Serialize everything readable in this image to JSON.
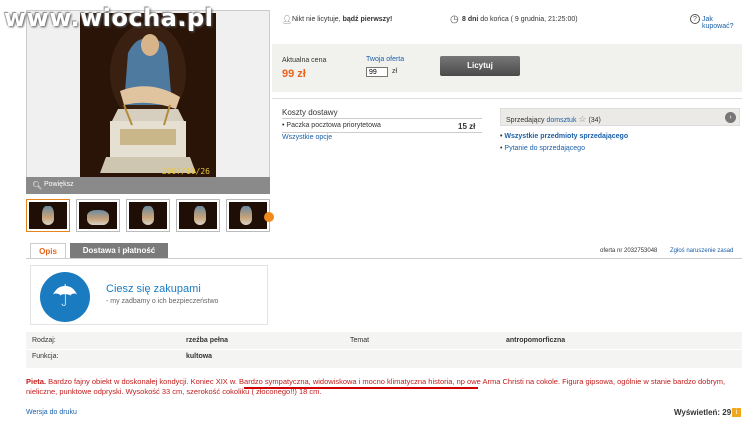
{
  "watermark": "www.wiocha.pl",
  "photo": {
    "zoom_label": "Powiększ",
    "date_stamp": "2007/10/26"
  },
  "top": {
    "bid_info_prefix": "Nikt nie licytuje,",
    "bid_info_bold": "bądź pierwszy!",
    "end_bold": "8 dni",
    "end_rest": "do końca ( 9 grudnia, 21:25:00)",
    "help_link": "Jak kupować?"
  },
  "price": {
    "label": "Aktualna cena",
    "value": "99 zł",
    "offer_label": "Twoja oferta",
    "offer_value": "99",
    "offer_unit": "zł",
    "bid_button": "Licytuj"
  },
  "shipping": {
    "title": "Koszty dostawy",
    "item": "Paczka pocztowa priorytetowa",
    "item_price": "15 zł",
    "all_options": "Wszystkie opcje"
  },
  "seller": {
    "prefix": "Sprzedający",
    "name": "domsztuk",
    "rating": "(34)",
    "link_items": "Wszystkie przedmioty sprzedającego",
    "link_ask": "Pytanie do sprzedającego"
  },
  "tabs": {
    "opis": "Opis",
    "dostawa": "Dostawa i płatność"
  },
  "offer_number": "oferta nr 2032753048",
  "report_link": "Zgłoś naruszenie zasad",
  "banner": {
    "title": "Ciesz się zakupami",
    "subtitle": "my zadbamy o ich bezpieczeństwo"
  },
  "attributes": {
    "rodzaj_label": "Rodzaj:",
    "rodzaj_value": "rzeźba pełna",
    "temat_label": "Temat",
    "temat_value": "antropomorficzna",
    "funkcja_label": "Funkcja:",
    "funkcja_value": "kultowa"
  },
  "description": {
    "bold": "Pieta.",
    "part1": " Bardzo fajny obiekt w doskonałej kondycji. Koniec XIX w. ",
    "highlight": "Bardzo sympatyczna, widowiskowa i mocno klimatyczna historia",
    "part2": ", np owe Arma Christi na cokole. Figura gipsowa, ogólnie w stanie bardzo dobrym, nieliczne, punktowe odpryski. Wysokość 33 cm, szerokość cokoliku ( złoconego!!) 18 cm."
  },
  "footer": {
    "print_link": "Wersja do druku",
    "views_label": "Wyświetleń: 29"
  }
}
